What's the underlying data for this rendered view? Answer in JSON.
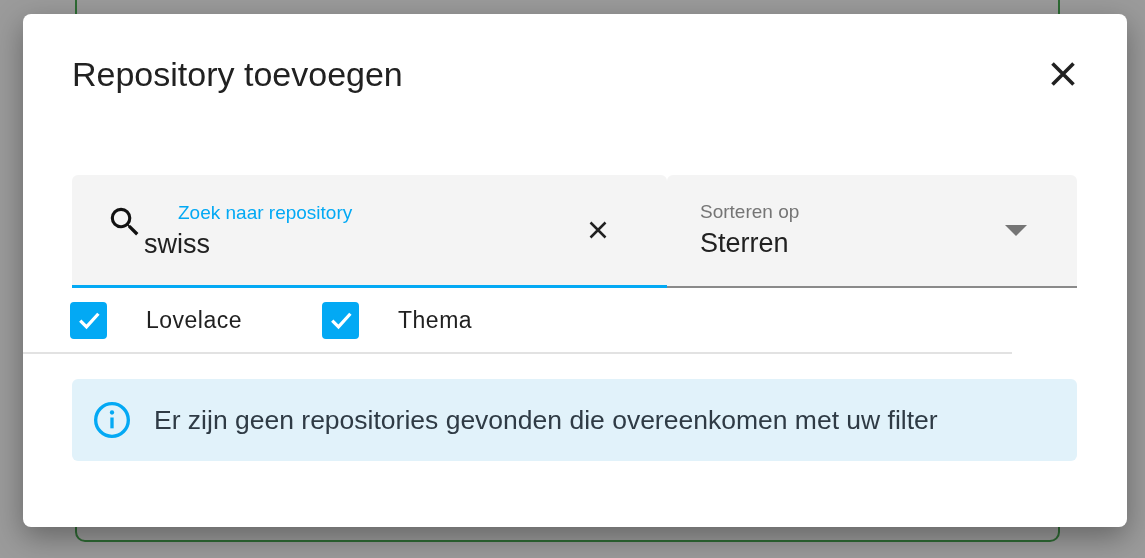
{
  "dialog": {
    "title": "Repository toevoegen"
  },
  "search": {
    "label": "Zoek naar repository",
    "value": "swiss",
    "focused": true
  },
  "sort": {
    "label": "Sorteren op",
    "value": "Sterren"
  },
  "filters": [
    {
      "label": "Lovelace",
      "checked": true
    },
    {
      "label": "Thema",
      "checked": true
    }
  ],
  "alert": {
    "kind": "info",
    "message": "Er zijn geen repositories gevonden die overeenkomen met uw filter"
  }
}
